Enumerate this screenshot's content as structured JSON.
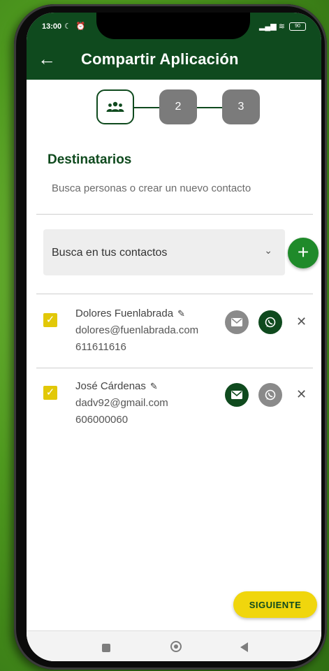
{
  "status_bar": {
    "time": "13:00",
    "icons_left": "☾ ⏰",
    "signal": "▂▄▆ ≋",
    "battery": "90"
  },
  "header": {
    "back_icon": "←",
    "title": "Compartir Aplicación"
  },
  "stepper": {
    "step1_icon": "group-icon",
    "step2": "2",
    "step3": "3"
  },
  "section": {
    "title": "Destinatarios",
    "subtitle": "Busca personas o crear un nuevo contacto"
  },
  "search": {
    "placeholder": "Busca en tus contactos",
    "add_icon": "+",
    "chevron": "⌄"
  },
  "contacts": [
    {
      "name": "Dolores Fuenlabrada",
      "email": "dolores@fuenlabrada.com",
      "phone": "611611616",
      "checked": true,
      "email_selected": false,
      "whatsapp_selected": true
    },
    {
      "name": "José Cárdenas",
      "email": "dadv92@gmail.com",
      "phone": "606000060",
      "checked": true,
      "email_selected": true,
      "whatsapp_selected": false
    }
  ],
  "actions": {
    "next_label": "SIGUIENTE"
  },
  "colors": {
    "primary": "#0f4a1e",
    "accent": "#f0d60d",
    "add": "#1f8a2a",
    "inactive": "#8a8a8a"
  }
}
